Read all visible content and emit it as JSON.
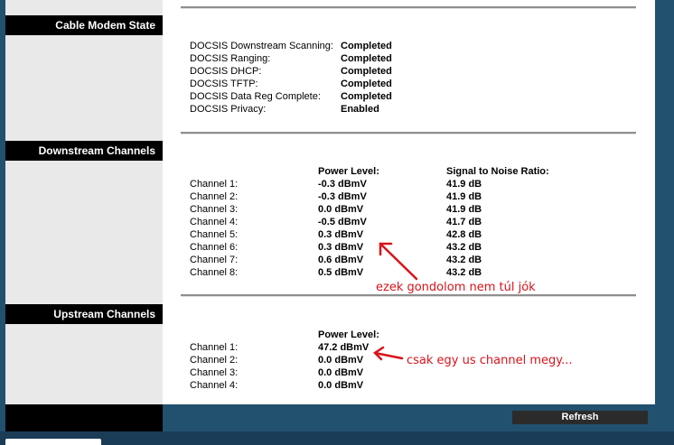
{
  "cable_modem_state": {
    "header": "Cable Modem State",
    "rows": [
      {
        "label": "DOCSIS Downstream Scanning:",
        "value": "Completed"
      },
      {
        "label": "DOCSIS Ranging:",
        "value": "Completed"
      },
      {
        "label": "DOCSIS DHCP:",
        "value": "Completed"
      },
      {
        "label": "DOCSIS TFTP:",
        "value": "Completed"
      },
      {
        "label": "DOCSIS Data Reg Complete:",
        "value": "Completed"
      },
      {
        "label": "DOCSIS Privacy:",
        "value": "Enabled"
      }
    ]
  },
  "downstream": {
    "header": "Downstream Channels",
    "col_power": "Power Level:",
    "col_snr": "Signal to Noise Ratio:",
    "rows": [
      {
        "channel": "Channel 1:",
        "power": "-0.3 dBmV",
        "snr": "41.9 dB"
      },
      {
        "channel": "Channel 2:",
        "power": "-0.3 dBmV",
        "snr": "41.9 dB"
      },
      {
        "channel": "Channel 3:",
        "power": "0.0 dBmV",
        "snr": "41.9 dB"
      },
      {
        "channel": "Channel 4:",
        "power": "-0.5 dBmV",
        "snr": "41.7 dB"
      },
      {
        "channel": "Channel 5:",
        "power": "0.3 dBmV",
        "snr": "42.8 dB"
      },
      {
        "channel": "Channel 6:",
        "power": "0.3 dBmV",
        "snr": "43.2 dB"
      },
      {
        "channel": "Channel 7:",
        "power": "0.6 dBmV",
        "snr": "43.2 dB"
      },
      {
        "channel": "Channel 8:",
        "power": "0.5 dBmV",
        "snr": "43.2 dB"
      }
    ]
  },
  "upstream": {
    "header": "Upstream Channels",
    "col_power": "Power Level:",
    "rows": [
      {
        "channel": "Channel 1:",
        "power": "47.2 dBmV"
      },
      {
        "channel": "Channel 2:",
        "power": "0.0 dBmV"
      },
      {
        "channel": "Channel 3:",
        "power": "0.0 dBmV"
      },
      {
        "channel": "Channel 4:",
        "power": "0.0 dBmV"
      }
    ]
  },
  "annotations": {
    "downstream_note": "ezek gondolom nem túl jók",
    "upstream_note": "csak egy us channel megy..."
  },
  "footer": {
    "refresh_label": "Refresh"
  },
  "colors": {
    "page_bg": "#22506f",
    "header_bg": "#000000",
    "annotation": "#d9131b"
  }
}
